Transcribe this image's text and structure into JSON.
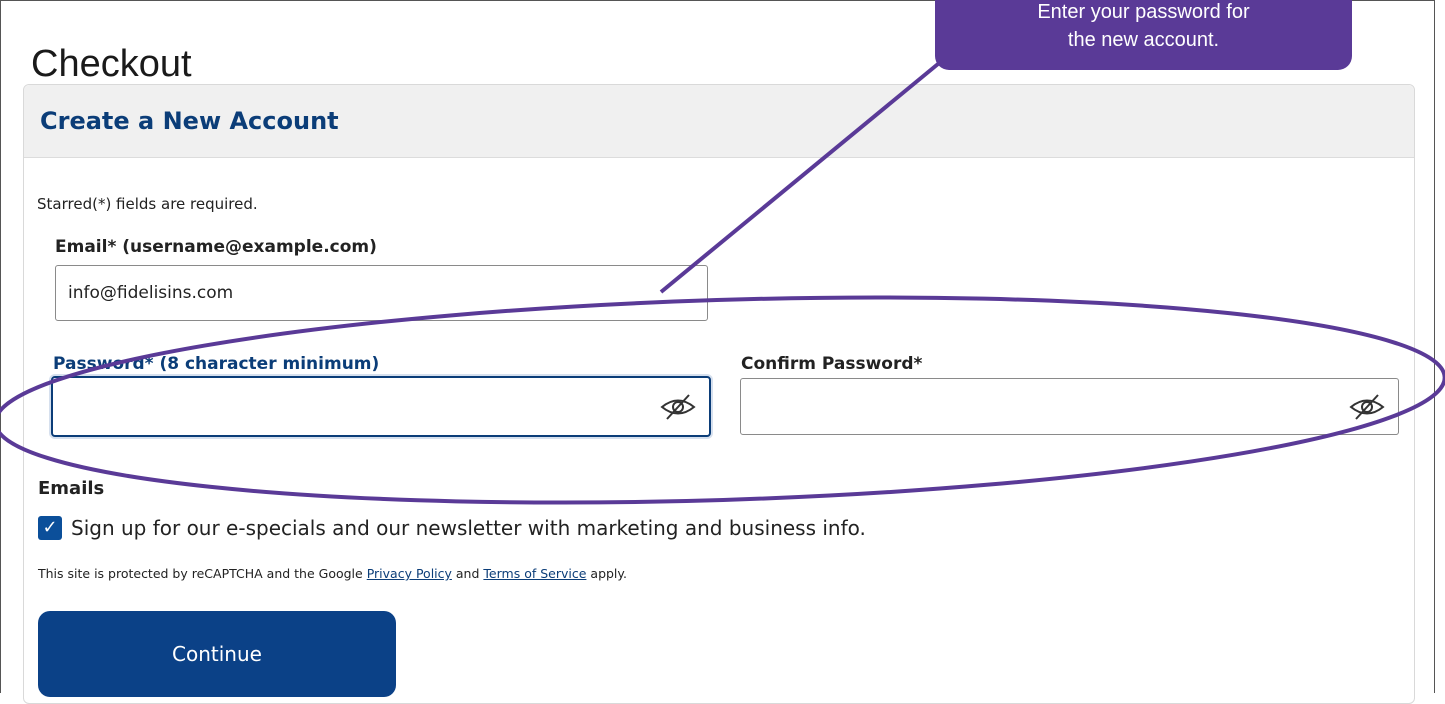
{
  "page": {
    "title": "Checkout"
  },
  "panel": {
    "title": "Create a New Account"
  },
  "form": {
    "required_note": "Starred(*) fields are required.",
    "email": {
      "label": "Email* (username@example.com)",
      "value": "info@fidelisins.com"
    },
    "password": {
      "label": "Password* (8 character minimum)",
      "value": "",
      "icon": "eye-slash-icon"
    },
    "confirm_password": {
      "label": "Confirm Password*",
      "value": "",
      "icon": "eye-slash-icon"
    },
    "emails_section": "Emails",
    "newsletter": {
      "checked": true,
      "label": "Sign up for our e-specials and our newsletter with marketing and business info."
    },
    "legal": {
      "prefix": "This site is protected by reCAPTCHA and the Google",
      "privacy_link": "Privacy Policy",
      "and": "and",
      "terms_link": "Terms of Service",
      "suffix": "apply."
    },
    "continue_label": "Continue"
  },
  "annotation": {
    "callout_text_line1": "Enter your password for",
    "callout_text_line2": "the new account.",
    "color": "#5a3a97"
  },
  "colors": {
    "brand": "#0b3d78",
    "button": "#0b4187"
  }
}
